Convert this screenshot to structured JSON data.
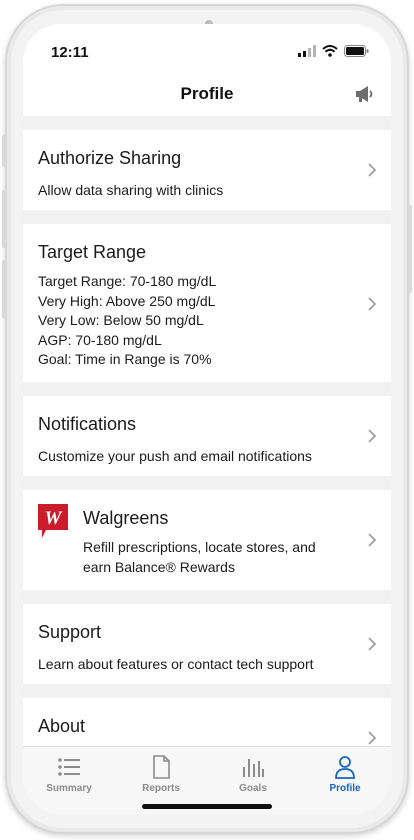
{
  "status": {
    "time": "12:11"
  },
  "nav": {
    "title": "Profile"
  },
  "cards": {
    "authorize": {
      "title": "Authorize Sharing",
      "subtitle": "Allow data sharing with clinics"
    },
    "target": {
      "title": "Target Range",
      "lines": [
        "Target Range: 70-180 mg/dL",
        "Very High: Above 250 mg/dL",
        "Very Low: Below 50 mg/dL",
        "AGP: 70-180 mg/dL",
        "Goal: Time in Range is 70%"
      ]
    },
    "notifications": {
      "title": "Notifications",
      "subtitle": "Customize your push and email notifications"
    },
    "walgreens": {
      "title": "Walgreens",
      "lines": [
        "Refill prescriptions, locate stores, and",
        "earn Balance® Rewards"
      ],
      "logo_letter": "W",
      "logo_color": "#cc1b2b"
    },
    "support": {
      "title": "Support",
      "subtitle": "Learn about features or contact tech support"
    },
    "about": {
      "title": "About"
    }
  },
  "tabs": [
    {
      "label": "Summary",
      "icon": "list-icon"
    },
    {
      "label": "Reports",
      "icon": "document-icon"
    },
    {
      "label": "Goals",
      "icon": "bar-chart-icon"
    },
    {
      "label": "Profile",
      "icon": "person-icon",
      "active": true
    }
  ],
  "colors": {
    "accent": "#1565c0",
    "divider": "#f1f1f1"
  }
}
